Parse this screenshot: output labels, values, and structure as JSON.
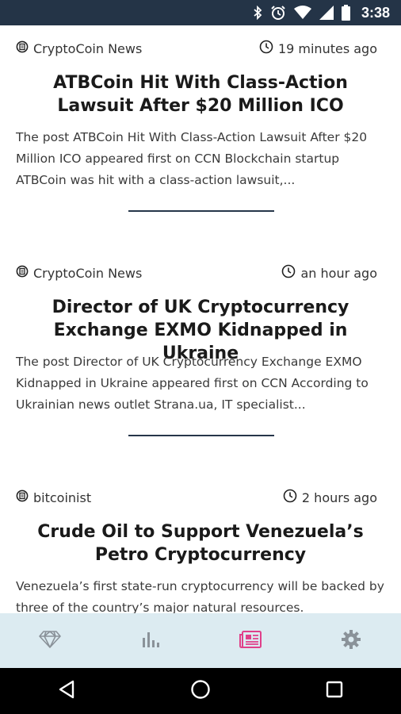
{
  "status_bar": {
    "time": "3:38",
    "icons": [
      "bluetooth-icon",
      "alarm-icon",
      "wifi-icon",
      "signal-icon",
      "battery-icon"
    ]
  },
  "articles": [
    {
      "source": "CryptoCoin News",
      "time_ago": "19 minutes ago",
      "headline": "ATBCoin Hit With Class-Action Lawsuit After $20 Million ICO",
      "excerpt": "The post ATBCoin Hit With Class-Action Lawsuit After $20 Million ICO appeared first on CCN Blockchain startup ATBCoin was hit with a class-action lawsuit,..."
    },
    {
      "source": "CryptoCoin News",
      "time_ago": "an hour ago",
      "headline": "Director of UK Cryptocurrency Exchange EXMO Kidnapped in Ukraine",
      "excerpt": "The post Director of UK Cryptocurrency Exchange EXMO Kidnapped in Ukraine appeared first on CCN According to Ukrainian news outlet Strana.ua, IT specialist..."
    },
    {
      "source": "bitcoinist",
      "time_ago": "2 hours ago",
      "headline": "Crude Oil to Support Venezuela’s Petro Cryptocurrency",
      "excerpt": "Venezuela’s first state-run cryptocurrency will be backed by three of the country’s major natural resources."
    }
  ],
  "bottom_nav": {
    "items": [
      "diamond-icon",
      "bar-chart-icon",
      "newspaper-icon",
      "settings-gear-icon"
    ],
    "active_index": 2,
    "active_color": "#e0408a",
    "inactive_color": "#8a9299"
  },
  "colors": {
    "status_bar": "#243447",
    "divider": "#26364a",
    "bottom_nav_bg": "#dcebf1"
  }
}
